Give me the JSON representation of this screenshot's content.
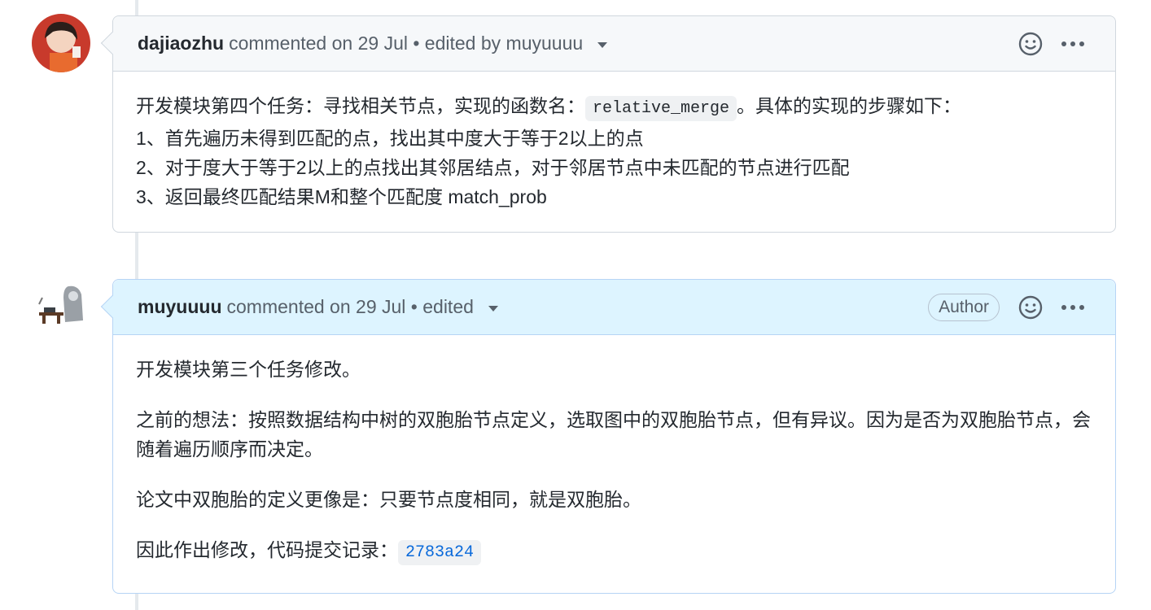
{
  "comments": [
    {
      "author": "dajiaozhu",
      "meta": "commented on 29 Jul • edited by muyuuuu",
      "lines": [
        {
          "before": "开发模块第四个任务：寻找相关节点，实现的函数名：",
          "code": "relative_merge",
          "after": "。具体的实现的步骤如下："
        },
        {
          "text": "1、首先遍历未得到匹配的点，找出其中度大于等于2以上的点"
        },
        {
          "text": "2、对于度大于等于2以上的点找出其邻居结点，对于邻居节点中未匹配的节点进行匹配"
        },
        {
          "text": "3、返回最终匹配结果M和整个匹配度 match_prob"
        }
      ]
    },
    {
      "author": "muyuuuu",
      "meta": "commented on 29 Jul • edited",
      "badge": "Author",
      "paragraphs": [
        "开发模块第三个任务修改。",
        "之前的想法：按照数据结构中树的双胞胎节点定义，选取图中的双胞胎节点，但有异议。因为是否为双胞胎节点，会随着遍历顺序而决定。",
        "论文中双胞胎的定义更像是：只要节点度相同，就是双胞胎。"
      ],
      "last_line": {
        "before": "因此作出修改，代码提交记录：",
        "commit": "2783a24"
      }
    }
  ],
  "icons": {
    "reaction": "smiley-icon",
    "more": "kebab-icon",
    "dropdown": "caret-down-icon"
  },
  "colors": {
    "link": "#0969da",
    "author_header_bg": "#ddf4ff",
    "header_bg": "#f6f8fa"
  }
}
